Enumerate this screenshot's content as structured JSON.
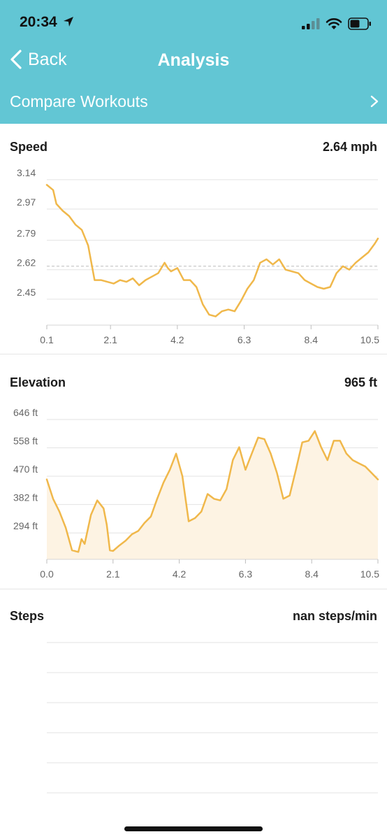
{
  "status_bar": {
    "time": "20:34",
    "location_icon": "location-arrow-icon",
    "signal_icon": "cellular-signal-icon",
    "wifi_icon": "wifi-icon",
    "battery_icon": "battery-icon"
  },
  "nav": {
    "back_label": "Back",
    "title": "Analysis"
  },
  "compare": {
    "label": "Compare Workouts"
  },
  "colors": {
    "header": "#62c6d4",
    "series": "#f0b84b",
    "area_fill": "#fdf3e3",
    "grid": "#e3e3e3",
    "axis_text": "#666666"
  },
  "speed": {
    "title": "Speed",
    "value": "2.64 mph",
    "chart_data": {
      "type": "line",
      "title": "",
      "xlabel": "",
      "ylabel": "",
      "yticks": [
        "3.14",
        "2.97",
        "2.79",
        "2.62",
        "2.45"
      ],
      "ytick_values": [
        3.14,
        2.97,
        2.79,
        2.62,
        2.45
      ],
      "xticks": [
        "0.1",
        "2.1",
        "4.2",
        "6.3",
        "8.4",
        "10.5"
      ],
      "xtick_values": [
        0.1,
        2.1,
        4.2,
        6.3,
        8.4,
        10.5
      ],
      "xlim": [
        0.1,
        10.5
      ],
      "ylim": [
        2.3,
        3.16
      ],
      "average": 2.64,
      "x": [
        0.1,
        0.3,
        0.4,
        0.6,
        0.8,
        1.0,
        1.2,
        1.4,
        1.6,
        1.8,
        2.0,
        2.2,
        2.4,
        2.6,
        2.8,
        3.0,
        3.2,
        3.4,
        3.6,
        3.8,
        3.9,
        4.0,
        4.2,
        4.4,
        4.6,
        4.8,
        5.0,
        5.2,
        5.4,
        5.6,
        5.8,
        6.0,
        6.2,
        6.4,
        6.6,
        6.8,
        7.0,
        7.2,
        7.4,
        7.6,
        7.8,
        8.0,
        8.2,
        8.4,
        8.6,
        8.8,
        9.0,
        9.2,
        9.4,
        9.6,
        9.8,
        10.0,
        10.2,
        10.4,
        10.5
      ],
      "y": [
        3.11,
        3.08,
        3.0,
        2.96,
        2.93,
        2.88,
        2.85,
        2.76,
        2.56,
        2.56,
        2.55,
        2.54,
        2.56,
        2.55,
        2.57,
        2.53,
        2.56,
        2.58,
        2.6,
        2.66,
        2.63,
        2.61,
        2.63,
        2.56,
        2.56,
        2.52,
        2.42,
        2.36,
        2.35,
        2.38,
        2.39,
        2.38,
        2.44,
        2.51,
        2.56,
        2.66,
        2.68,
        2.65,
        2.68,
        2.62,
        2.61,
        2.6,
        2.56,
        2.54,
        2.52,
        2.51,
        2.52,
        2.6,
        2.64,
        2.62,
        2.66,
        2.69,
        2.72,
        2.77,
        2.8
      ]
    }
  },
  "elevation": {
    "title": "Elevation",
    "value": "965 ft",
    "chart_data": {
      "type": "area",
      "title": "",
      "xlabel": "",
      "ylabel": "",
      "yticks": [
        "646 ft",
        "558 ft",
        "470 ft",
        "382 ft",
        "294 ft"
      ],
      "ytick_values": [
        646,
        558,
        470,
        382,
        294
      ],
      "xticks": [
        "0.0",
        "2.1",
        "4.2",
        "6.3",
        "8.4",
        "10.5"
      ],
      "xtick_values": [
        0.0,
        2.1,
        4.2,
        6.3,
        8.4,
        10.5
      ],
      "xlim": [
        0.0,
        10.5
      ],
      "ylim": [
        212,
        646
      ],
      "x": [
        0.0,
        0.2,
        0.4,
        0.6,
        0.8,
        1.0,
        1.1,
        1.2,
        1.4,
        1.6,
        1.8,
        1.9,
        2.0,
        2.1,
        2.3,
        2.5,
        2.7,
        2.9,
        3.1,
        3.3,
        3.5,
        3.7,
        3.9,
        4.1,
        4.3,
        4.4,
        4.5,
        4.7,
        4.9,
        5.1,
        5.3,
        5.5,
        5.7,
        5.9,
        6.1,
        6.3,
        6.5,
        6.7,
        6.9,
        7.1,
        7.3,
        7.5,
        7.7,
        7.9,
        8.1,
        8.3,
        8.5,
        8.7,
        8.9,
        9.1,
        9.3,
        9.5,
        9.7,
        9.9,
        10.1,
        10.3,
        10.5
      ],
      "y": [
        460,
        400,
        360,
        310,
        240,
        235,
        275,
        260,
        350,
        395,
        370,
        320,
        240,
        238,
        255,
        270,
        290,
        300,
        325,
        345,
        400,
        450,
        490,
        540,
        470,
        400,
        330,
        340,
        360,
        415,
        400,
        395,
        430,
        520,
        560,
        490,
        540,
        590,
        585,
        540,
        480,
        400,
        410,
        490,
        575,
        580,
        610,
        560,
        520,
        580,
        580,
        540,
        520,
        510,
        500,
        480,
        460
      ]
    }
  },
  "steps": {
    "title": "Steps",
    "value": "nan steps/min",
    "chart_data": {
      "type": "line",
      "title": "",
      "xlabel": "",
      "ylabel": "",
      "series": []
    }
  }
}
